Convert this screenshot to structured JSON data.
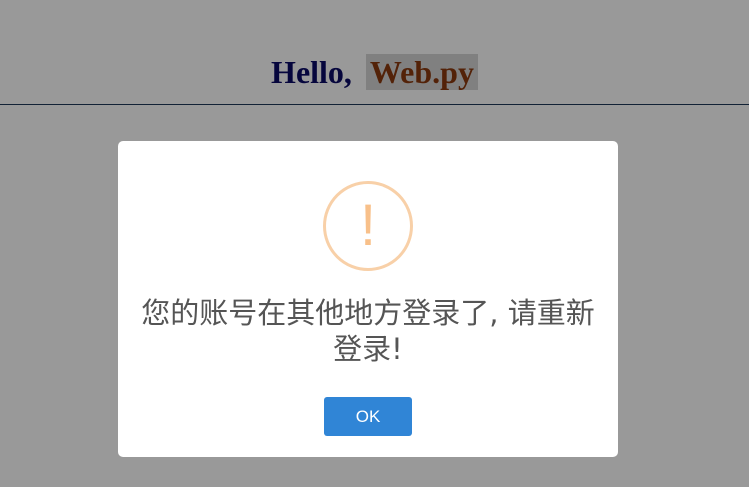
{
  "page": {
    "title_hello": "Hello,",
    "title_brand": "Web.py"
  },
  "modal": {
    "icon": "warning-exclamation-icon",
    "icon_glyph": "!",
    "message": "您的账号在其他地方登录了, 请重新登录!",
    "ok_label": "OK"
  },
  "colors": {
    "overlay": "rgba(0,0,0,0.4)",
    "hello_text": "#0a0a66",
    "brand_text": "#8b3a0e",
    "icon_border": "#f8d0a8",
    "icon_glyph": "#f8c08a",
    "message_text": "#555555",
    "ok_button_bg": "#3085d6",
    "ok_button_text": "#ffffff"
  }
}
